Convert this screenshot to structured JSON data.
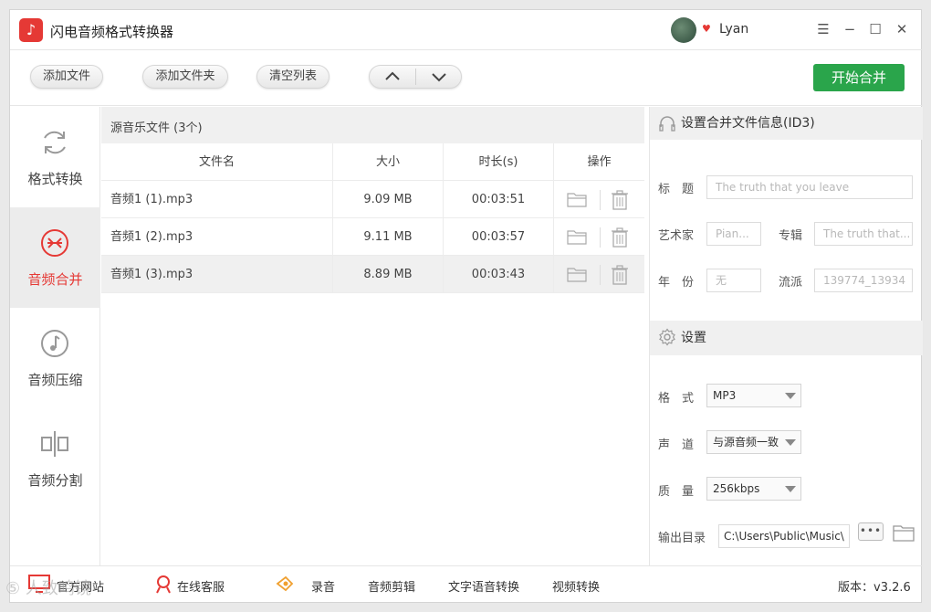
{
  "app": {
    "title": "闪电音频格式转换器",
    "user_name": "Lyan"
  },
  "colors": {
    "accent": "#e53935",
    "primary_button": "#2aa54b"
  },
  "toolbar": {
    "add_file": "添加文件",
    "add_folder": "添加文件夹",
    "clear_list": "清空列表",
    "start_merge": "开始合并"
  },
  "sidebar": {
    "items": [
      {
        "label": "格式转换",
        "icon": "refresh-icon"
      },
      {
        "label": "音频合并",
        "icon": "merge-icon"
      },
      {
        "label": "音频压缩",
        "icon": "music-note-icon"
      },
      {
        "label": "音频分割",
        "icon": "split-icon"
      }
    ],
    "active_index": 1
  },
  "file_list": {
    "header": "源音乐文件 (3个)",
    "columns": [
      "文件名",
      "大小",
      "时长(s)",
      "操作"
    ],
    "rows": [
      {
        "name": "音频1 (1).mp3",
        "size": "9.09 MB",
        "duration": "00:03:51"
      },
      {
        "name": "音频1 (2).mp3",
        "size": "9.11 MB",
        "duration": "00:03:57"
      },
      {
        "name": "音频1 (3).mp3",
        "size": "8.89 MB",
        "duration": "00:03:43"
      }
    ],
    "selected_row": 2
  },
  "id3": {
    "header": "设置合并文件信息(ID3)",
    "title_label": "标　题",
    "title_value": "The truth that you leave",
    "artist_label": "艺术家",
    "artist_value": "Pian...",
    "album_label": "专辑",
    "album_value": "The truth that...",
    "year_label": "年　份",
    "year_value": "无",
    "genre_label": "流派",
    "genre_value": "139774_13934"
  },
  "settings": {
    "header": "设置",
    "format_label": "格　式",
    "format_value": "MP3",
    "channel_label": "声　道",
    "channel_value": "与源音频一致",
    "quality_label": "质　量",
    "quality_value": "256kbps",
    "output_label": "输出目录",
    "output_value": "C:\\Users\\Public\\Music\\",
    "browse_label": "•••"
  },
  "bottom": {
    "website": "官方网站",
    "service": "在线客服",
    "record": "录音",
    "audio_edit": "音频剪辑",
    "tts": "文字语音转换",
    "video_convert": "视频转换",
    "version": "版本：v3.2.6"
  },
  "watermark": "⑤ 人致鸣镜"
}
